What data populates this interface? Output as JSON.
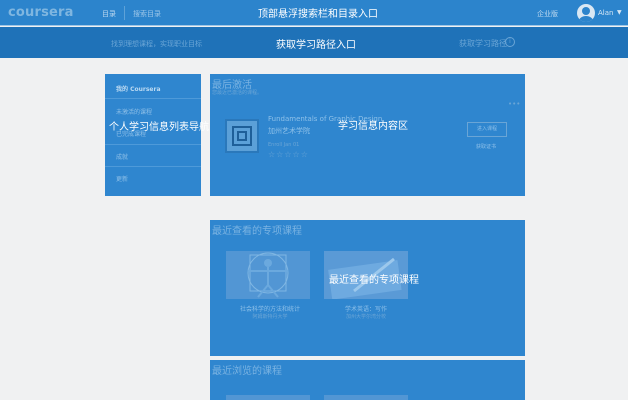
{
  "header": {
    "logo": "coursera",
    "nav_catalog": "目录",
    "search_placeholder": "搜索目录",
    "annotation": "顶部悬浮搜索栏和目录入口",
    "enterprise": "企业版",
    "user_name": "Alan"
  },
  "path_bar": {
    "prompt": "找到理想课程，实现职业目标",
    "annotation": "获取学习路径入口",
    "link": "获取学习路径",
    "link_icon": "i"
  },
  "sidebar": {
    "annotation": "个人学习信息列表导航",
    "items": [
      {
        "label": "我的 Coursera",
        "active": true
      },
      {
        "label": "未激活的课程",
        "active": false
      },
      {
        "label": "已完成课程",
        "active": false
      },
      {
        "label": "成就",
        "active": false
      },
      {
        "label": "更新",
        "active": false
      }
    ]
  },
  "recent_activity": {
    "title": "最后激活",
    "subtitle": "您最近已激活的课程。",
    "annotation": "学习信息内容区",
    "more_icon": "more-icon",
    "course": {
      "title": "Fundamentals of Graphic Design",
      "school": "加州艺术学院",
      "enrolled": "Enroll Jan 01",
      "stars": "☆☆☆☆☆",
      "enter_button": "进入课程",
      "more_link": "获取证书"
    }
  },
  "specializations": {
    "title": "最近查看的专项课程",
    "annotation": "最近查看的专项课程",
    "items": [
      {
        "title": "社会科学的方法和统计",
        "school": "阿姆斯特丹大学"
      },
      {
        "title": "学术英语：写作",
        "school": "加州大学尔湾分校"
      }
    ]
  },
  "recent_courses": {
    "title": "最近浏览的课程"
  },
  "colors": {
    "topbar": "#2c84cc",
    "pathbar": "#1f72b8",
    "panel": "#2f86cf",
    "background": "#f0f1f2"
  }
}
